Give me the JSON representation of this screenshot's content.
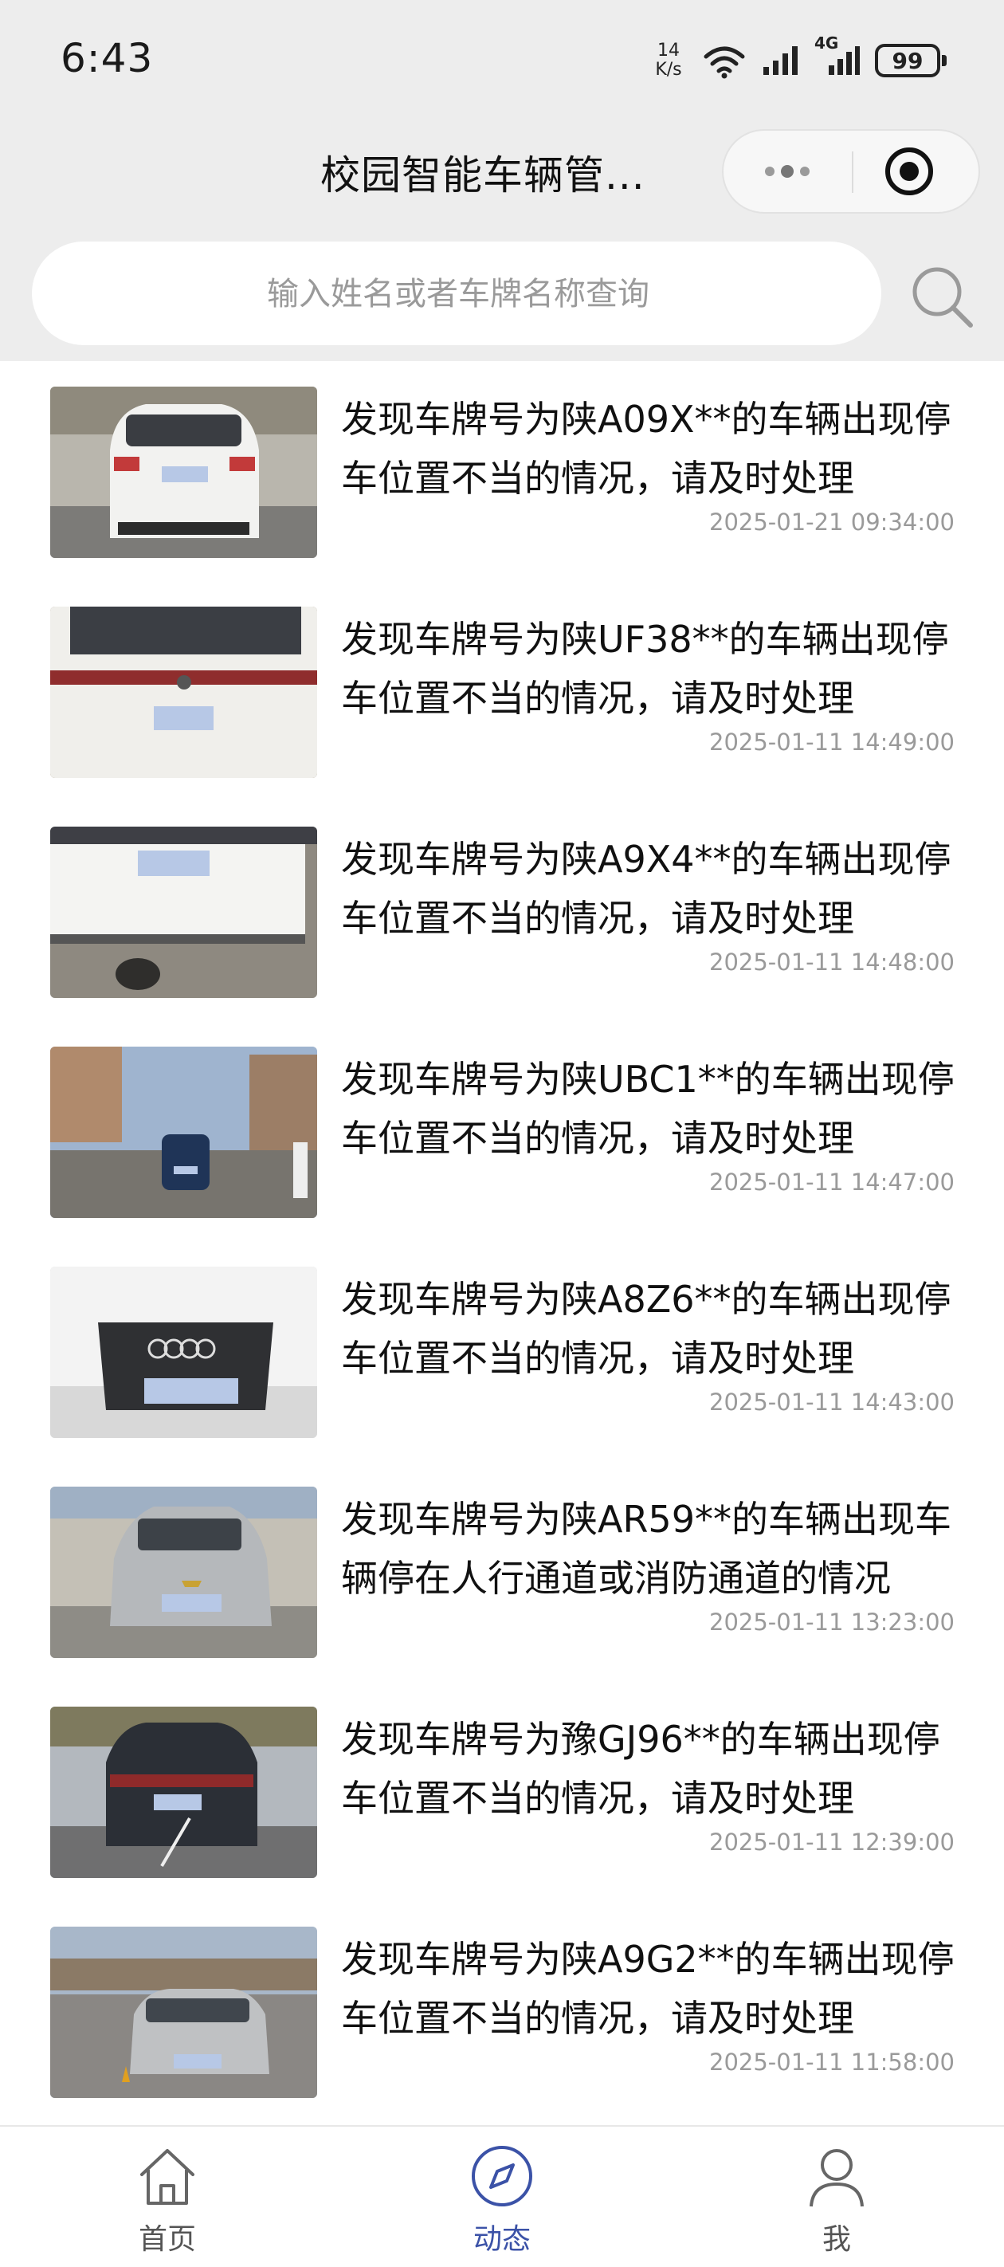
{
  "status_bar": {
    "time": "6:43",
    "net_speed_value": "14",
    "net_speed_unit": "K/s",
    "signal_label": "4G",
    "battery": "99"
  },
  "nav": {
    "title": "校园智能车辆管..."
  },
  "search": {
    "placeholder": "输入姓名或者车牌名称查询",
    "value": ""
  },
  "records": [
    {
      "text": "发现车牌号为陕A09X**的车辆出现停车位置不当的情况，请及时处理",
      "time": "2025-01-21 09:34:00"
    },
    {
      "text": "发现车牌号为陕UF38**的车辆出现停车位置不当的情况，请及时处理",
      "time": "2025-01-11 14:49:00"
    },
    {
      "text": "发现车牌号为陕A9X4**的车辆出现停车位置不当的情况，请及时处理",
      "time": "2025-01-11 14:48:00"
    },
    {
      "text": "发现车牌号为陕UBC1**的车辆出现停车位置不当的情况，请及时处理",
      "time": "2025-01-11 14:47:00"
    },
    {
      "text": "发现车牌号为陕A8Z6**的车辆出现停车位置不当的情况，请及时处理",
      "time": "2025-01-11 14:43:00"
    },
    {
      "text": "发现车牌号为陕AR59**的车辆出现车辆停在人行通道或消防通道的情况",
      "time": "2025-01-11 13:23:00"
    },
    {
      "text": "发现车牌号为豫GJ96**的车辆出现停车位置不当的情况，请及时处理",
      "time": "2025-01-11 12:39:00"
    },
    {
      "text": "发现车牌号为陕A9G2**的车辆出现停车位置不当的情况，请及时处理",
      "time": "2025-01-11 11:58:00"
    }
  ],
  "tabbar": {
    "home": "首页",
    "feed": "动态",
    "me": "我",
    "active_color": "#3b52a7"
  }
}
